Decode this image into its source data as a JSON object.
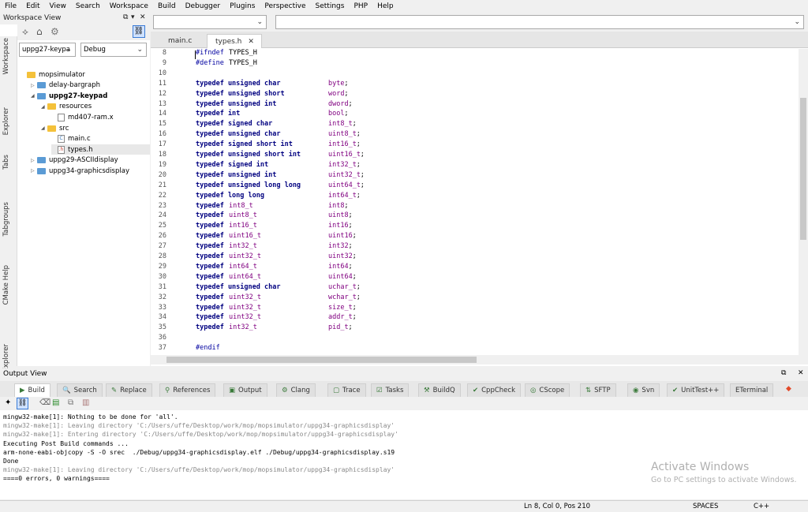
{
  "menu": [
    "File",
    "Edit",
    "View",
    "Search",
    "Workspace",
    "Build",
    "Debugger",
    "Plugins",
    "Perspective",
    "Settings",
    "PHP",
    "Help"
  ],
  "workspace": {
    "title": "Workspace View",
    "project_combo": "uppg27-keypa",
    "config_combo": "Debug",
    "side_tabs": [
      "Workspace",
      "Explorer",
      "Tabs",
      "Tabgroups",
      "CMake Help",
      "DbExplorer"
    ],
    "tree": [
      {
        "label": "mopsimulator",
        "kind": "root",
        "indent": 0,
        "expanded": ""
      },
      {
        "label": "delay-bargraph",
        "kind": "project",
        "indent": 1,
        "expanded": "▷"
      },
      {
        "label": "uppg27-keypad",
        "kind": "project",
        "indent": 1,
        "expanded": "◢",
        "bold": true
      },
      {
        "label": "resources",
        "kind": "folder",
        "indent": 2,
        "expanded": "◢"
      },
      {
        "label": "md407-ram.x",
        "kind": "file",
        "indent": 3,
        "expanded": "",
        "ficon": ""
      },
      {
        "label": "src",
        "kind": "folder",
        "indent": 2,
        "expanded": "◢"
      },
      {
        "label": "main.c",
        "kind": "file",
        "indent": 3,
        "expanded": "",
        "ficon": "C"
      },
      {
        "label": "types.h",
        "kind": "file",
        "indent": 3,
        "expanded": "",
        "ficon": ".h"
      },
      {
        "label": "uppg29-ASCIIdisplay",
        "kind": "project",
        "indent": 1,
        "expanded": "▷"
      },
      {
        "label": "uppg34-graphicsdisplay",
        "kind": "project",
        "indent": 1,
        "expanded": "▷"
      }
    ]
  },
  "editor": {
    "tabs": [
      {
        "label": "main.c",
        "active": false
      },
      {
        "label": "types.h",
        "active": true,
        "close": "✕"
      }
    ],
    "lines": [
      {
        "n": "8",
        "t": [
          [
            "pp",
            "#ifndef"
          ],
          [
            "",
            "TYPES_H"
          ]
        ]
      },
      {
        "n": "9",
        "t": [
          [
            "pp",
            "#define"
          ],
          [
            "",
            "TYPES_H"
          ]
        ]
      },
      {
        "n": "10",
        "t": []
      },
      {
        "n": "11",
        "t": [
          [
            "kw",
            "typedef unsigned char"
          ],
          [
            "ty",
            "byte"
          ],
          [
            "",
            ";"
          ]
        ]
      },
      {
        "n": "12",
        "t": [
          [
            "kw",
            "typedef unsigned short"
          ],
          [
            "ty",
            "word"
          ],
          [
            "",
            ";"
          ]
        ]
      },
      {
        "n": "13",
        "t": [
          [
            "kw",
            "typedef unsigned int"
          ],
          [
            "ty",
            "dword"
          ],
          [
            "",
            ";"
          ]
        ]
      },
      {
        "n": "14",
        "t": [
          [
            "kw",
            "typedef int"
          ],
          [
            "ty",
            "bool"
          ],
          [
            "",
            ";"
          ]
        ]
      },
      {
        "n": "15",
        "t": [
          [
            "kw",
            "typedef signed char"
          ],
          [
            "ty",
            "int8_t"
          ],
          [
            "",
            ";"
          ]
        ]
      },
      {
        "n": "16",
        "t": [
          [
            "kw",
            "typedef unsigned char"
          ],
          [
            "ty",
            "uint8_t"
          ],
          [
            "",
            ";"
          ]
        ]
      },
      {
        "n": "17",
        "t": [
          [
            "kw",
            "typedef signed short int"
          ],
          [
            "ty",
            "int16_t"
          ],
          [
            "",
            ";"
          ]
        ]
      },
      {
        "n": "18",
        "t": [
          [
            "kw",
            "typedef unsigned short int"
          ],
          [
            "ty",
            "uint16_t"
          ],
          [
            "",
            ";"
          ]
        ]
      },
      {
        "n": "19",
        "t": [
          [
            "kw",
            "typedef signed int"
          ],
          [
            "ty",
            "int32_t"
          ],
          [
            "",
            ";"
          ]
        ]
      },
      {
        "n": "20",
        "t": [
          [
            "kw",
            "typedef unsigned int"
          ],
          [
            "ty",
            "uint32_t"
          ],
          [
            "",
            ";"
          ]
        ]
      },
      {
        "n": "21",
        "t": [
          [
            "kw",
            "typedef unsigned long long"
          ],
          [
            "ty",
            "uint64_t"
          ],
          [
            "",
            ";"
          ]
        ]
      },
      {
        "n": "22",
        "t": [
          [
            "kw",
            "typedef long long"
          ],
          [
            "ty",
            "int64_t"
          ],
          [
            "",
            ";"
          ]
        ]
      },
      {
        "n": "23",
        "t": [
          [
            "kw",
            "typedef"
          ],
          [
            "ty",
            "int8_t"
          ],
          [
            "ty",
            "int8"
          ],
          [
            "",
            ";"
          ]
        ]
      },
      {
        "n": "24",
        "t": [
          [
            "kw",
            "typedef"
          ],
          [
            "ty",
            "uint8_t"
          ],
          [
            "ty",
            "uint8"
          ],
          [
            "",
            ";"
          ]
        ]
      },
      {
        "n": "25",
        "t": [
          [
            "kw",
            "typedef"
          ],
          [
            "ty",
            "int16_t"
          ],
          [
            "ty",
            "int16"
          ],
          [
            "",
            ";"
          ]
        ]
      },
      {
        "n": "26",
        "t": [
          [
            "kw",
            "typedef"
          ],
          [
            "ty",
            "uint16_t"
          ],
          [
            "ty",
            "uint16"
          ],
          [
            "",
            ";"
          ]
        ]
      },
      {
        "n": "27",
        "t": [
          [
            "kw",
            "typedef"
          ],
          [
            "ty",
            "int32_t"
          ],
          [
            "ty",
            "int32"
          ],
          [
            "",
            ";"
          ]
        ]
      },
      {
        "n": "28",
        "t": [
          [
            "kw",
            "typedef"
          ],
          [
            "ty",
            "uint32_t"
          ],
          [
            "ty",
            "uint32"
          ],
          [
            "",
            ";"
          ]
        ]
      },
      {
        "n": "29",
        "t": [
          [
            "kw",
            "typedef"
          ],
          [
            "ty",
            "int64_t"
          ],
          [
            "ty",
            "int64"
          ],
          [
            "",
            ";"
          ]
        ]
      },
      {
        "n": "30",
        "t": [
          [
            "kw",
            "typedef"
          ],
          [
            "ty",
            "uint64_t"
          ],
          [
            "ty",
            "uint64"
          ],
          [
            "",
            ";"
          ]
        ]
      },
      {
        "n": "31",
        "t": [
          [
            "kw",
            "typedef unsigned char"
          ],
          [
            "ty",
            "uchar_t"
          ],
          [
            "",
            ";"
          ]
        ]
      },
      {
        "n": "32",
        "t": [
          [
            "kw",
            "typedef"
          ],
          [
            "ty",
            "uint32_t"
          ],
          [
            "ty",
            "wchar_t"
          ],
          [
            "",
            ";"
          ]
        ]
      },
      {
        "n": "33",
        "t": [
          [
            "kw",
            "typedef"
          ],
          [
            "ty",
            "uint32_t"
          ],
          [
            "ty",
            "size_t"
          ],
          [
            "",
            ";"
          ]
        ]
      },
      {
        "n": "34",
        "t": [
          [
            "kw",
            "typedef"
          ],
          [
            "ty",
            "uint32_t"
          ],
          [
            "ty",
            "addr_t"
          ],
          [
            "",
            ";"
          ]
        ]
      },
      {
        "n": "35",
        "t": [
          [
            "kw",
            "typedef"
          ],
          [
            "ty",
            "int32_t"
          ],
          [
            "ty",
            "pid_t"
          ],
          [
            "",
            ";"
          ]
        ]
      },
      {
        "n": "36",
        "t": []
      },
      {
        "n": "37",
        "t": [
          [
            "pp",
            "#endif"
          ]
        ]
      }
    ]
  },
  "output": {
    "title": "Output View",
    "tabs": [
      {
        "label": "Build",
        "icon": "▶",
        "active": true
      },
      {
        "label": "Search",
        "icon": "🔍"
      },
      {
        "label": "Replace",
        "icon": "✎"
      },
      {
        "label": "References",
        "icon": "⚲"
      },
      {
        "label": "Output",
        "icon": "▣"
      },
      {
        "label": "Clang",
        "icon": "⚙"
      },
      {
        "label": "Trace",
        "icon": "▢"
      },
      {
        "label": "Tasks",
        "icon": "☑"
      },
      {
        "label": "BuildQ",
        "icon": "⚒"
      },
      {
        "label": "CppCheck",
        "icon": "✔"
      },
      {
        "label": "CScope",
        "icon": "◎"
      },
      {
        "label": "SFTP",
        "icon": "⇅"
      },
      {
        "label": "Svn",
        "icon": "◉"
      },
      {
        "label": "UnitTest++",
        "icon": "✔"
      },
      {
        "label": "ETerminal",
        "icon": ""
      }
    ],
    "lines": [
      {
        "text": "mingw32-make[1]: Nothing to be done for 'all'.",
        "dim": false
      },
      {
        "text": "mingw32-make[1]: Leaving directory 'C:/Users/uffe/Desktop/work/mop/mopsimulator/uppg34-graphicsdisplay'",
        "dim": true
      },
      {
        "text": "mingw32-make[1]: Entering directory 'C:/Users/uffe/Desktop/work/mop/mopsimulator/uppg34-graphicsdisplay'",
        "dim": true
      },
      {
        "text": "Executing Post Build commands ...",
        "dim": false
      },
      {
        "text": "arm-none-eabi-objcopy -S -O srec  ./Debug/uppg34-graphicsdisplay.elf ./Debug/uppg34-graphicsdisplay.s19",
        "dim": false
      },
      {
        "text": "Done",
        "dim": false
      },
      {
        "text": "mingw32-make[1]: Leaving directory 'C:/Users/uffe/Desktop/work/mop/mopsimulator/uppg34-graphicsdisplay'",
        "dim": true
      },
      {
        "text": "====0 errors, 0 warnings====",
        "dim": false
      }
    ]
  },
  "watermark": {
    "title": "Activate Windows",
    "sub": "Go to PC settings to activate Windows."
  },
  "status": {
    "position": "Ln 8, Col 0, Pos 210",
    "indent": "SPACES",
    "lang": "C++"
  }
}
